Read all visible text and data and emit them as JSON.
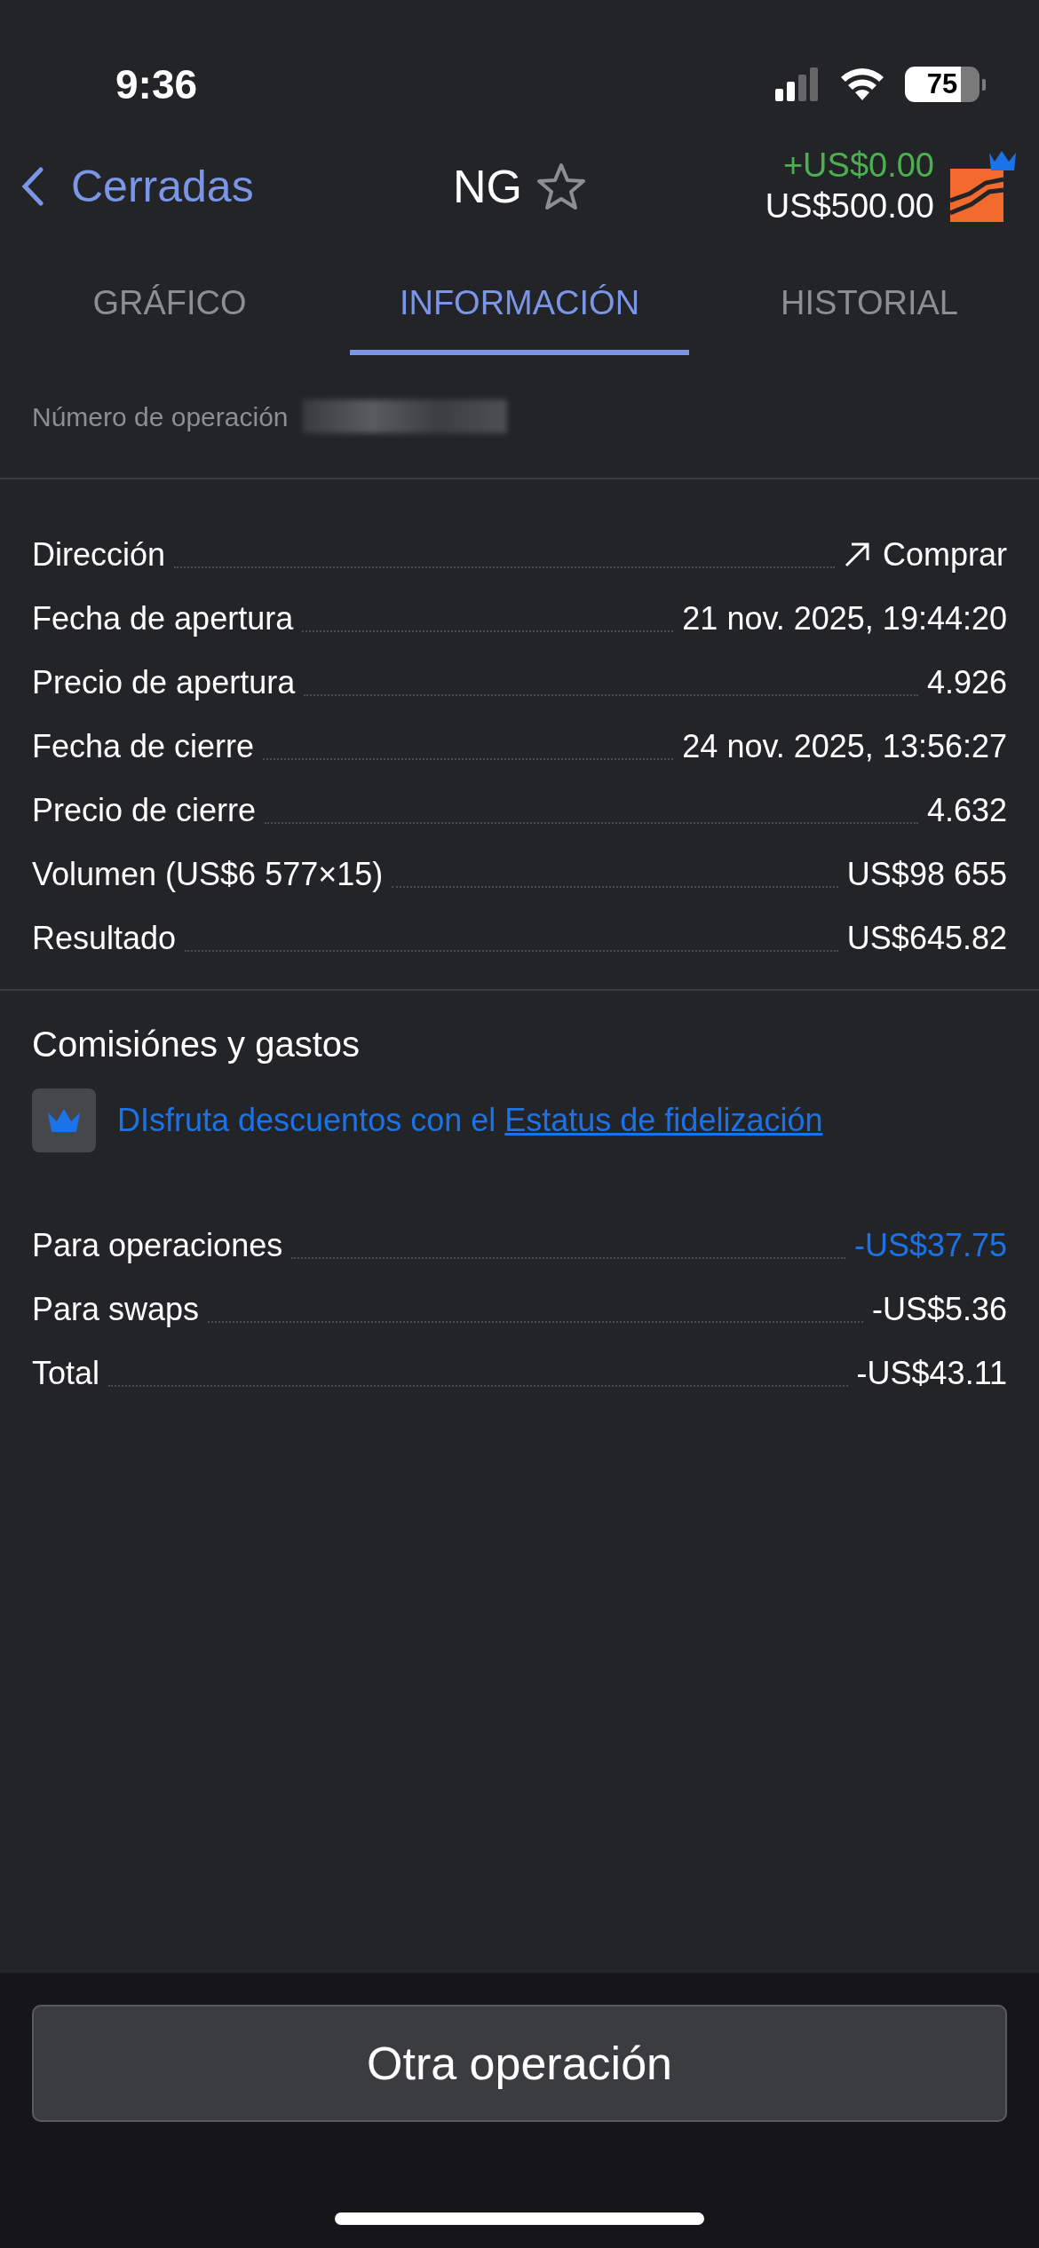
{
  "status_bar": {
    "time": "9:36",
    "battery": "75"
  },
  "header": {
    "back_label": "Cerradas",
    "symbol": "NG",
    "favorite": false,
    "profit": "+US$0.00",
    "balance": "US$500.00"
  },
  "tabs": [
    {
      "label": "GRÁFICO",
      "selected": false
    },
    {
      "label": "INFORMACIÓN",
      "selected": true
    },
    {
      "label": "HISTORIAL",
      "selected": false
    }
  ],
  "operation_number": {
    "label": "Número de operación"
  },
  "details": [
    {
      "label": "Dirección",
      "value": "Comprar",
      "kind": "direction"
    },
    {
      "label": "Fecha de apertura",
      "value": "21 nov. 2025, 19:44:20",
      "kind": "plain"
    },
    {
      "label": "Precio de apertura",
      "value": "4.926",
      "kind": "plain"
    },
    {
      "label": "Fecha de cierre",
      "value": "24 nov. 2025, 13:56:27",
      "kind": "plain"
    },
    {
      "label": "Precio de cierre",
      "value": "4.632",
      "kind": "plain"
    },
    {
      "label": "Volumen (US$6 577×15)",
      "value": "US$98 655",
      "kind": "plain"
    },
    {
      "label": "Resultado",
      "value": "US$645.82",
      "kind": "plain"
    }
  ],
  "fees": {
    "title": "Comisiónes y gastos",
    "promo_text": "DIsfruta descuentos con el",
    "promo_link": "Estatus de fidelización",
    "rows": [
      {
        "label": "Para operaciones",
        "value": "-US$37.75",
        "kind": "link"
      },
      {
        "label": "Para swaps",
        "value": "-US$5.36",
        "kind": "plain"
      },
      {
        "label": "Total",
        "value": "-US$43.11",
        "kind": "plain"
      }
    ]
  },
  "footer": {
    "button": "Otra operación"
  }
}
